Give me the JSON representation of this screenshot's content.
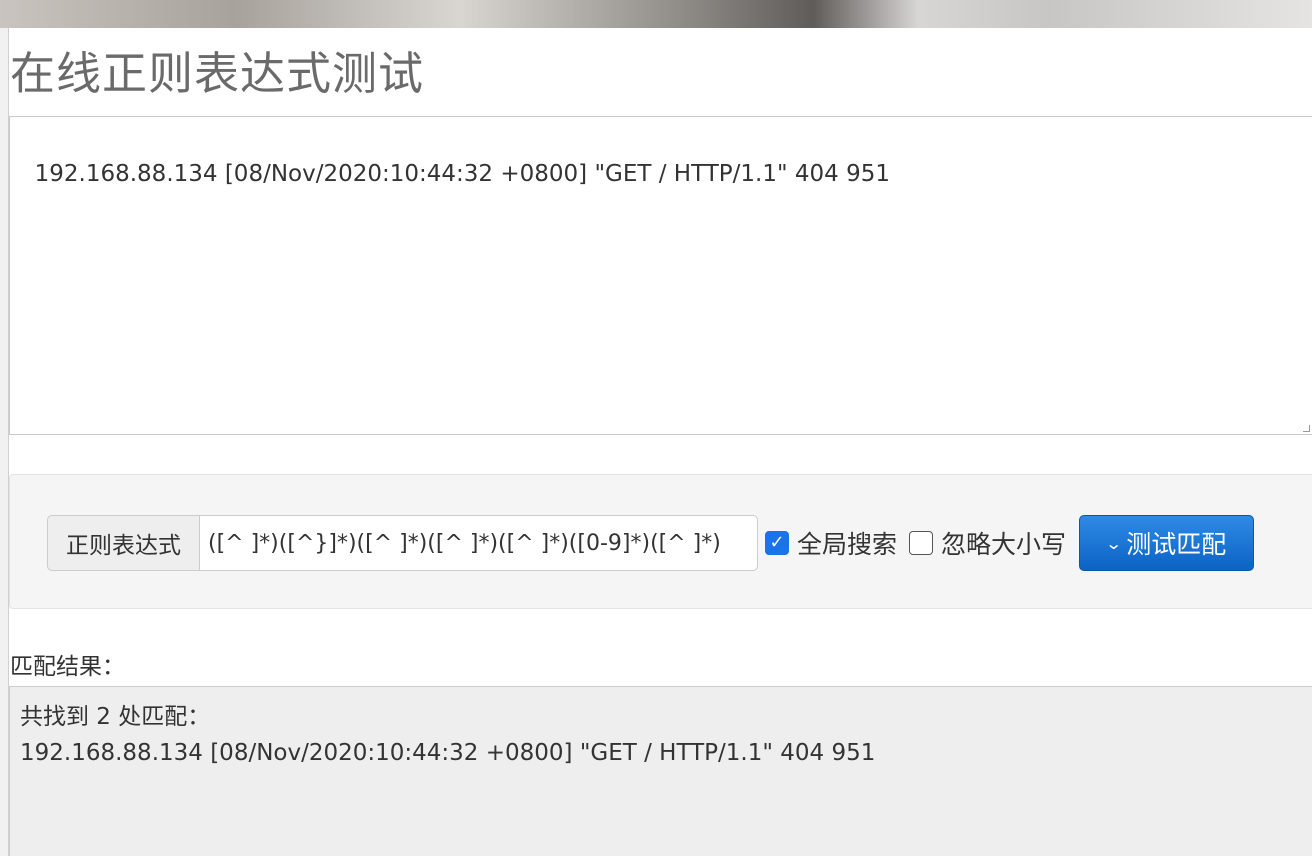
{
  "page": {
    "title": "在线正则表达式测试"
  },
  "source": {
    "text": "192.168.88.134 [08/Nov/2020:10:44:32 +0800] \"GET / HTTP/1.1\" 404 951"
  },
  "controls": {
    "regex_label": "正则表达式",
    "regex_value": "([^ ]*)([^}]*)([^ ]*)([^ ]*)([^ ]*)([0-9]*)([^ ]*)",
    "global_search": {
      "label": "全局搜索",
      "checked": true
    },
    "ignore_case": {
      "label": "忽略大小写",
      "checked": false
    },
    "test_button_label": "测试匹配",
    "check_glyph": "✓",
    "chevron_glyph": "⌄"
  },
  "result": {
    "label": "匹配结果：",
    "summary": "共找到 2 处匹配：",
    "match_line": "192.168.88.134 [08/Nov/2020:10:44:32 +0800] \"GET / HTTP/1.1\" 404 951"
  },
  "colors": {
    "accent": "#1a73e8",
    "button_top": "#2f8ae5",
    "button_bottom": "#0b63c4",
    "title": "#6a6a6a"
  }
}
